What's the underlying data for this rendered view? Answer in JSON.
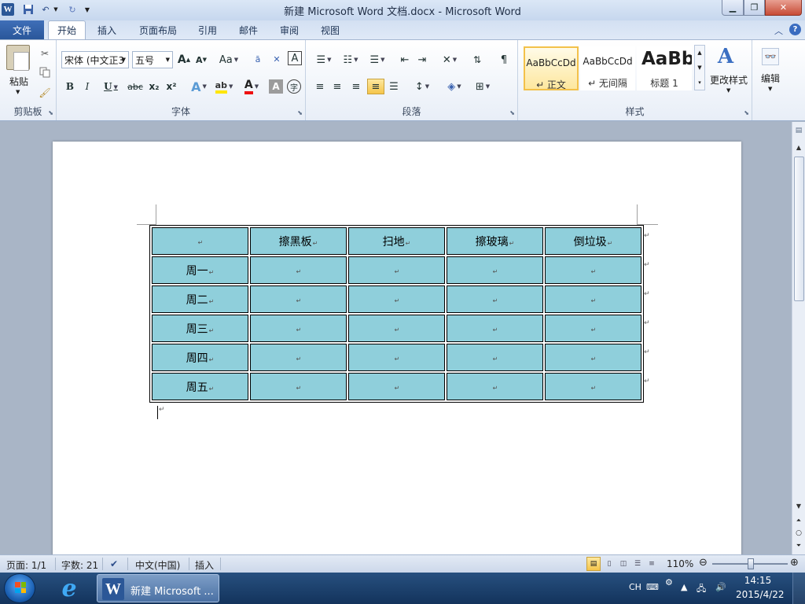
{
  "app": {
    "title": "新建 Microsoft Word 文档.docx - Microsoft Word"
  },
  "tabs": [
    "文件",
    "开始",
    "插入",
    "页面布局",
    "引用",
    "邮件",
    "审阅",
    "视图"
  ],
  "ribbon": {
    "clipboard": {
      "paste_label": "粘贴",
      "group_label": "剪贴板"
    },
    "font": {
      "font_name": "宋体 (中文正3",
      "font_size": "五号",
      "grow_label": "A",
      "shrink_label": "A",
      "case_label": "Aa",
      "bold_label": "B",
      "italic_label": "I",
      "underline_label": "U",
      "strike_label": "abc",
      "subscript_label": "x₂",
      "superscript_label": "x²",
      "group_label": "字体"
    },
    "paragraph": {
      "group_label": "段落"
    },
    "styles": {
      "items": [
        {
          "sample": "AaBbCcDd",
          "name": "↵ 正文"
        },
        {
          "sample": "AaBbCcDd",
          "name": "↵ 无间隔"
        },
        {
          "sample": "AaBb",
          "name": "标题 1"
        }
      ],
      "change_label": "更改样式",
      "group_label": "样式"
    },
    "editing": {
      "label": "编辑"
    }
  },
  "document": {
    "table": {
      "header": [
        "",
        "擦黑板",
        "扫地",
        "擦玻璃",
        "倒垃圾"
      ],
      "rows": [
        [
          "周一",
          "",
          "",
          "",
          ""
        ],
        [
          "周二",
          "",
          "",
          "",
          ""
        ],
        [
          "周三",
          "",
          "",
          "",
          ""
        ],
        [
          "周四",
          "",
          "",
          "",
          ""
        ],
        [
          "周五",
          "",
          "",
          "",
          ""
        ]
      ],
      "cell_color": "#8fcfdb"
    }
  },
  "statusbar": {
    "page": "页面: 1/1",
    "words": "字数: 21",
    "language": "中文(中国)",
    "mode": "插入",
    "zoom": "110%",
    "zoom_level_percent": 110
  },
  "taskbar": {
    "word_label": "新建 Microsoft ...",
    "ime": "CH",
    "time": "14:15",
    "date": "2015/4/22"
  },
  "colors": {
    "file_tab": "#2a579a",
    "accent": "#2b5797",
    "table_fill": "#8fcfdb"
  }
}
